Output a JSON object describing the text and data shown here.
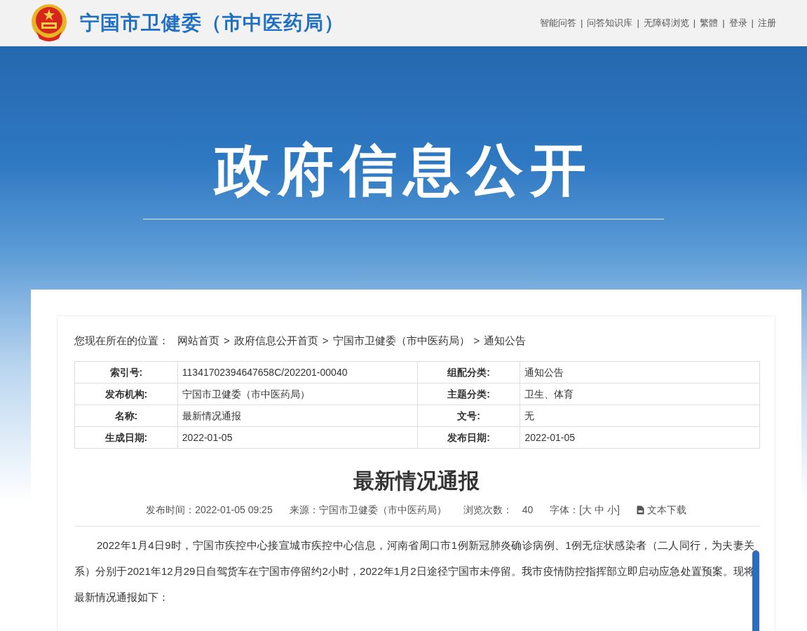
{
  "header": {
    "site_name": "宁国市卫健委（市中医药局）",
    "separator": "|",
    "links": [
      "智能问答",
      "问答知识库",
      "无障碍浏览",
      "繁體",
      "登录",
      "注册"
    ]
  },
  "banner": {
    "title": "政府信息公开"
  },
  "breadcrumb": {
    "label": "您现在所在的位置：",
    "separator": ">",
    "items": [
      "网站首页",
      "政府信息公开首页",
      "宁国市卫健委（市中医药局）",
      "通知公告"
    ]
  },
  "info_table": {
    "rows": [
      {
        "cells": [
          "索引号:",
          "11341702394647658C/202201-00040",
          "组配分类:",
          "通知公告"
        ]
      },
      {
        "cells": [
          "发布机构:",
          "宁国市卫健委（市中医药局）",
          "主题分类:",
          "卫生、体育"
        ]
      },
      {
        "cells": [
          "名称:",
          "最新情况通报",
          "文号:",
          "无"
        ]
      },
      {
        "cells": [
          "生成日期:",
          "2022-01-05",
          "发布日期:",
          "2022-01-05"
        ]
      }
    ]
  },
  "article": {
    "title": "最新情况通报",
    "meta": [
      "发布时间：2022-01-05 09:25",
      "来源：宁国市卫健委（市中医药局）",
      "浏览次数：　40",
      "字体：[大 中 小]"
    ],
    "download": "文本下载",
    "paragraph": "2022年1月4日9时，宁国市疾控中心接宣城市疾控中心信息，河南省周口市1例新冠肺炎确诊病例、1例无症状感染者（二人同行，为夫妻关系）分别于2021年12月29日自驾货车在宁国市停留约2小时，2022年1月2日途径宁国市未停留。我市疫情防控指挥部立即启动应急处置预案。现将最新情况通报如下："
  }
}
